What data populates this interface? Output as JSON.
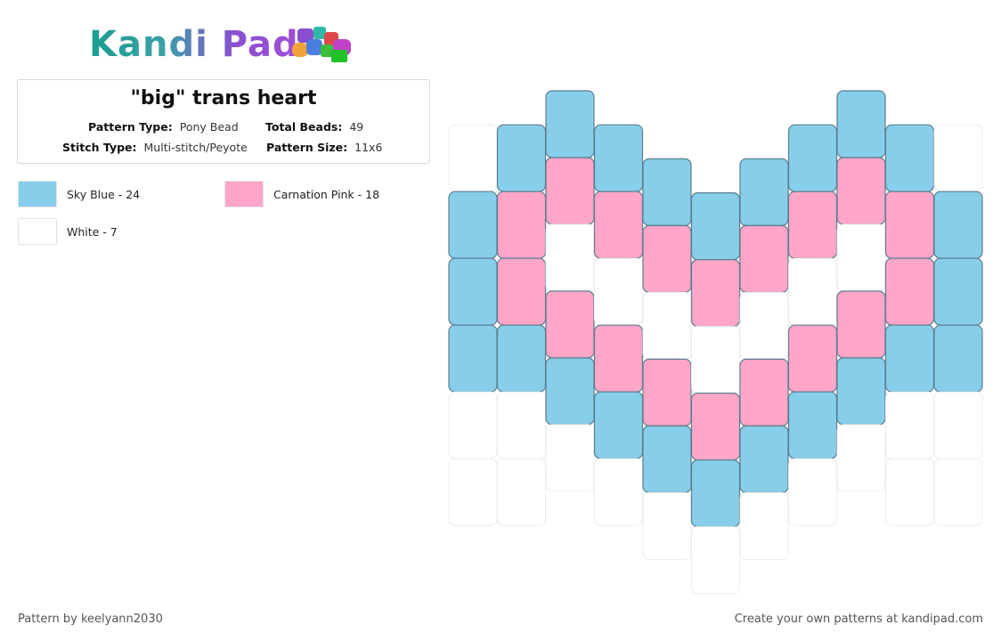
{
  "brand": {
    "name": "Kandi Pad",
    "beads_icon": "bead-pile-icon"
  },
  "pattern": {
    "title": "\"big\" trans heart",
    "pattern_type_label": "Pattern Type:",
    "pattern_type": "Pony Bead",
    "total_beads_label": "Total Beads:",
    "total_beads": "49",
    "stitch_type_label": "Stitch Type:",
    "stitch_type": "Multi-stitch/Peyote",
    "pattern_size_label": "Pattern Size:",
    "pattern_size": "11x6"
  },
  "legend": [
    {
      "label": "Sky Blue - 24",
      "color": "#87ceeb"
    },
    {
      "label": "Carnation Pink - 18",
      "color": "#ffa6c9"
    },
    {
      "label": "White - 7",
      "color": "#ffffff"
    }
  ],
  "grid": {
    "columns": [
      [
        "W",
        "B",
        "B",
        "B",
        "W",
        "W"
      ],
      [
        "B",
        "P",
        "P",
        "B",
        "W",
        "W"
      ],
      [
        "B",
        "P",
        "W",
        "P",
        "B",
        "W"
      ],
      [
        "B",
        "P",
        "W",
        "P",
        "B",
        "W"
      ],
      [
        "B",
        "P",
        "W",
        "P",
        "B",
        "W"
      ],
      [
        "B",
        "P",
        "W",
        "P",
        "B",
        "W"
      ],
      [
        "B",
        "P",
        "W",
        "P",
        "B",
        "W"
      ],
      [
        "B",
        "P",
        "W",
        "P",
        "B",
        "W"
      ],
      [
        "B",
        "P",
        "W",
        "P",
        "B",
        "W"
      ],
      [
        "B",
        "P",
        "P",
        "B",
        "W",
        "W"
      ],
      [
        "W",
        "B",
        "B",
        "B",
        "W",
        "W"
      ]
    ],
    "colors": {
      "B": "#87ceeb",
      "P": "#ffa6c9",
      "W": "#ffffff"
    }
  },
  "footer": {
    "credit": "Pattern by keelyann2030",
    "cta": "Create your own patterns at kandipad.com"
  }
}
